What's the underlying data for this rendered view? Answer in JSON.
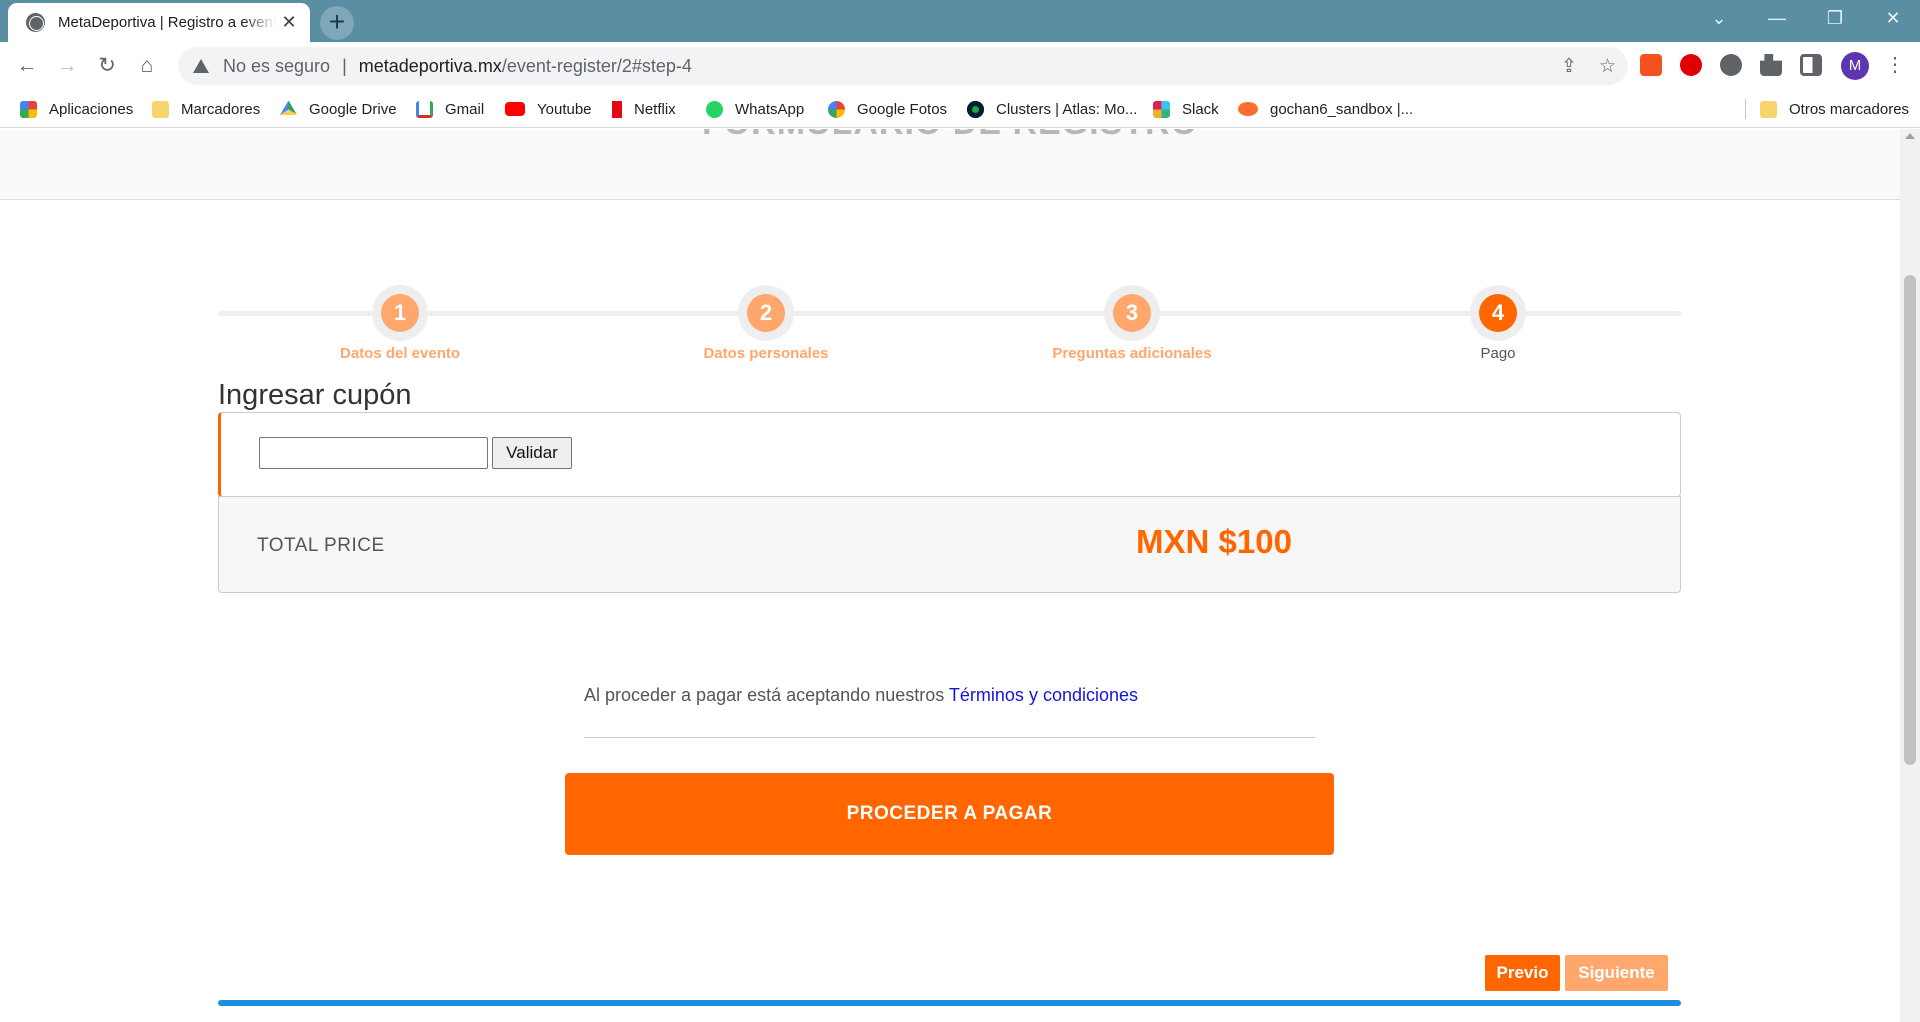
{
  "browser": {
    "tab_title": "MetaDeportiva | Registro a evento",
    "tab_close": "✕",
    "new_tab": "+",
    "window_controls": [
      "⌄",
      "—",
      "❐",
      "✕"
    ],
    "nav": {
      "back": "←",
      "forward": "→",
      "reload": "↻",
      "home": "⌂"
    },
    "omnibox": {
      "status": "No es seguro",
      "separator": "|",
      "domain": "metadeportiva.mx",
      "path": "/event-register/2#step-4"
    },
    "omnibox_actions": [
      "⇪",
      "☆"
    ],
    "avatar_initial": "M",
    "menu": "⋮"
  },
  "bookmarks": [
    {
      "label": "Aplicaciones",
      "icon": "apps-grid-icon",
      "color": "#ea4335"
    },
    {
      "label": "Marcadores",
      "icon": "folder-icon",
      "color": "#f7d46c"
    },
    {
      "label": "Google Drive",
      "icon": "google-drive-icon",
      "color": "#1fa463"
    },
    {
      "label": "Gmail",
      "icon": "gmail-icon",
      "color": "#d93025"
    },
    {
      "label": "Youtube",
      "icon": "youtube-icon",
      "color": "#ff0000"
    },
    {
      "label": "Netflix",
      "icon": "netflix-icon",
      "color": "#e50914"
    },
    {
      "label": "WhatsApp",
      "icon": "whatsapp-icon",
      "color": "#25d366"
    },
    {
      "label": "Google Fotos",
      "icon": "google-photos-icon",
      "color": "#fbbc04"
    },
    {
      "label": "Clusters | Atlas: Mo...",
      "icon": "mongodb-icon",
      "color": "#13aa52"
    },
    {
      "label": "Slack",
      "icon": "slack-icon",
      "color": "#611f69"
    },
    {
      "label": "gochan6_sandbox |...",
      "icon": "cpanel-icon",
      "color": "#ff6c2c"
    }
  ],
  "other_bookmarks": "Otros marcadores",
  "page": {
    "header_title": "FORMULARIO DE REGISTRO",
    "steps": [
      {
        "number": "1",
        "label": "Datos del evento"
      },
      {
        "number": "2",
        "label": "Datos personales"
      },
      {
        "number": "3",
        "label": "Preguntas adicionales"
      },
      {
        "number": "4",
        "label": "Pago"
      }
    ],
    "active_step": 4,
    "coupon": {
      "title": "Ingresar cupón",
      "input_value": "",
      "validate_label": "Validar"
    },
    "total": {
      "label": "TOTAL PRICE",
      "value": "MXN $100"
    },
    "terms": {
      "text": "Al proceder a pagar está aceptando nuestros ",
      "link": "Términos y condiciones"
    },
    "pay_button": "PROCEDER A PAGAR",
    "prev_button": "Previo",
    "next_button": "Siguiente"
  },
  "colors": {
    "accent": "#ff6600",
    "accent_light": "#ffa76d",
    "link": "#1515d8",
    "tabbar": "#5a8ea3",
    "progress_bar": "#1e8fe0"
  }
}
